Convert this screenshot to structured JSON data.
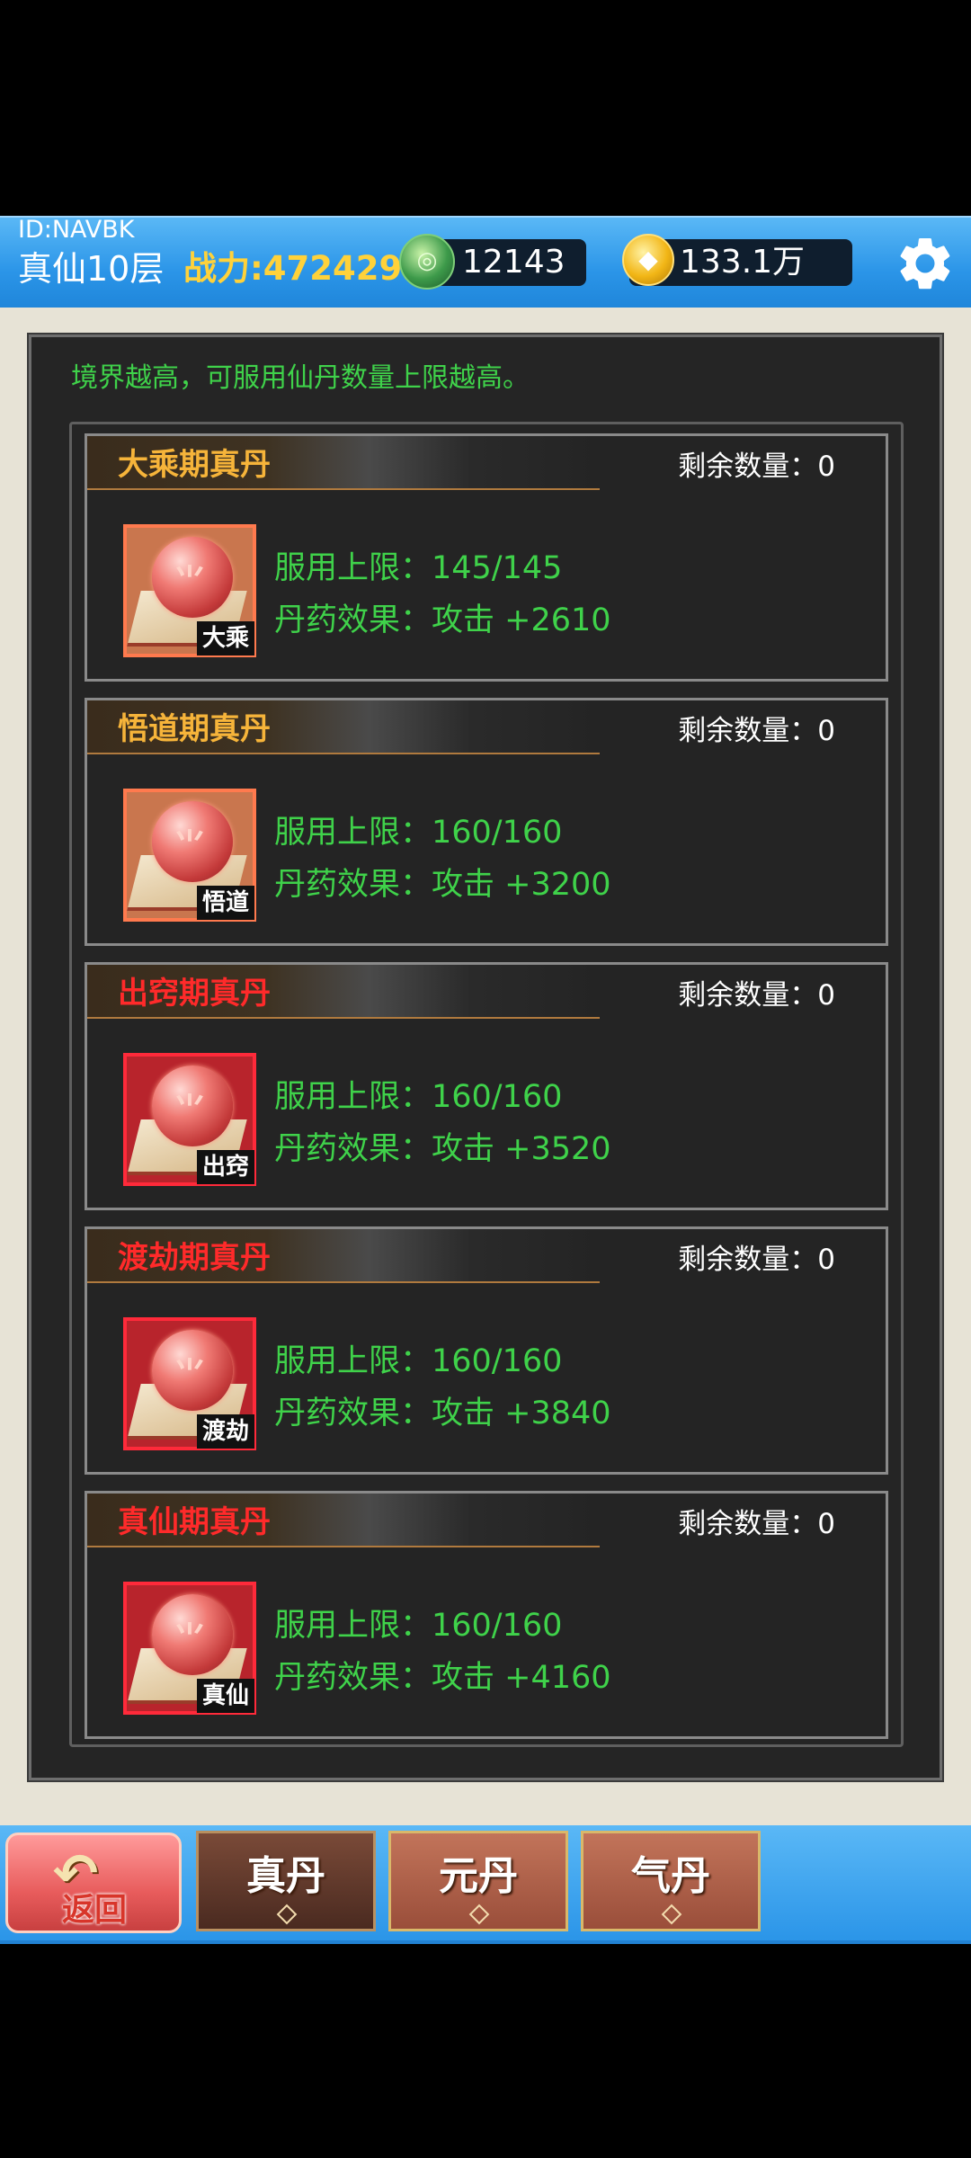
{
  "header": {
    "player_id": "ID:NAVBK",
    "realm": "真仙10层",
    "power": "战力:4724295",
    "jade_amount": "12143",
    "gold_amount": "133.1万",
    "jade_icon_glyph": "◎",
    "gold_icon_glyph": "◆"
  },
  "panel": {
    "hint": "境界越高，可服用仙丹数量上限越高。"
  },
  "elixirs": [
    {
      "title": "大乘期真丹",
      "title_color": "#f6b43a",
      "remaining": "剩余数量：0",
      "limit": "服用上限：145/145",
      "effect": "丹药效果：攻击 +2610",
      "tag": "大乘",
      "frame_color": "#ff7a4e"
    },
    {
      "title": "悟道期真丹",
      "title_color": "#f6b43a",
      "remaining": "剩余数量：0",
      "limit": "服用上限：160/160",
      "effect": "丹药效果：攻击 +3200",
      "tag": "悟道",
      "frame_color": "#ff7a4e"
    },
    {
      "title": "出窍期真丹",
      "title_color": "#ff2a2a",
      "remaining": "剩余数量：0",
      "limit": "服用上限：160/160",
      "effect": "丹药效果：攻击 +3520",
      "tag": "出窍",
      "frame_color": "#ff2a3a"
    },
    {
      "title": "渡劫期真丹",
      "title_color": "#ff2a2a",
      "remaining": "剩余数量：0",
      "limit": "服用上限：160/160",
      "effect": "丹药效果：攻击 +3840",
      "tag": "渡劫",
      "frame_color": "#ff2a3a"
    },
    {
      "title": "真仙期真丹",
      "title_color": "#ff2a2a",
      "remaining": "剩余数量：0",
      "limit": "服用上限：160/160",
      "effect": "丹药效果：攻击 +4160",
      "tag": "真仙",
      "frame_color": "#ff2a3a"
    }
  ],
  "bottom_nav": {
    "back_label": "返回",
    "back_icon_glyph": "↶",
    "tabs": [
      {
        "label": "真丹",
        "active": true
      },
      {
        "label": "元丹",
        "active": false
      },
      {
        "label": "气丹",
        "active": false
      }
    ]
  },
  "icons": {
    "settings": "gear-icon",
    "back": "back-arrow-icon",
    "jade": "jade-coin-icon",
    "gold": "gold-coin-icon",
    "elixir": "elixir-pill-icon"
  }
}
